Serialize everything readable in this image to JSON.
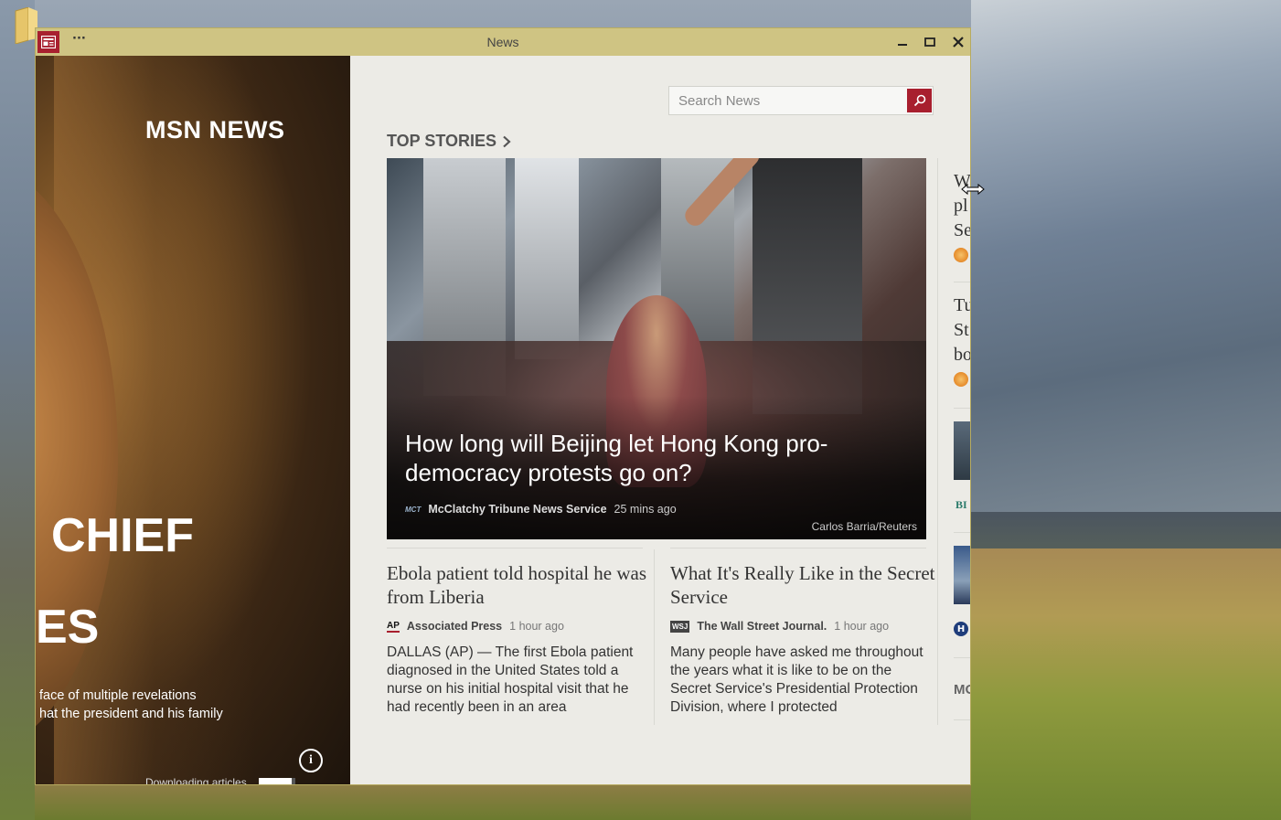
{
  "window": {
    "title": "News",
    "menu_label": "···"
  },
  "hero": {
    "brand": "MSN NEWS",
    "headline_line1": "CHIEF",
    "headline_line2": "ES",
    "summary_line1": "face of multiple revelations",
    "summary_line2": "hat the president and his family",
    "status_text": "Downloading articles",
    "download_progress": 0.9
  },
  "search": {
    "placeholder": "Search News"
  },
  "section": {
    "title": "TOP STORIES"
  },
  "main_story": {
    "headline": "How long will Beijing let Hong Kong pro-democracy protests go on?",
    "source_logo": "MCT",
    "source": "McClatchy Tribune News Service",
    "time": "25 mins ago",
    "credit": "Carlos Barria/Reuters"
  },
  "stories": [
    {
      "title": "Ebola patient told hospital he was from Liberia",
      "source_logo": "AP",
      "source": "Associated Press",
      "time": "1 hour ago",
      "body": "DALLAS (AP) — The first Ebola patient diagnosed in the United States told a nurse on his initial hospital visit that he had recently been in an area"
    },
    {
      "title": "What It's Really Like in the Secret Service",
      "source_logo": "WSJ",
      "source": "The Wall Street Journal.",
      "time": "1 hour ago",
      "body": "Many people have asked me throughout the years what it is like to be on the Secret Service's Presidential Protection Division, where I protected"
    }
  ],
  "right_column": {
    "item1_lines": [
      "W",
      "pl",
      "Se"
    ],
    "item2_lines": [
      "Tu",
      "St",
      "bo"
    ],
    "item3_source": "BI",
    "item4_source": "H",
    "more_label": "MO"
  },
  "colors": {
    "accent": "#a81f2e",
    "titlebar": "#cfc483",
    "content_bg": "#ecebe6"
  }
}
